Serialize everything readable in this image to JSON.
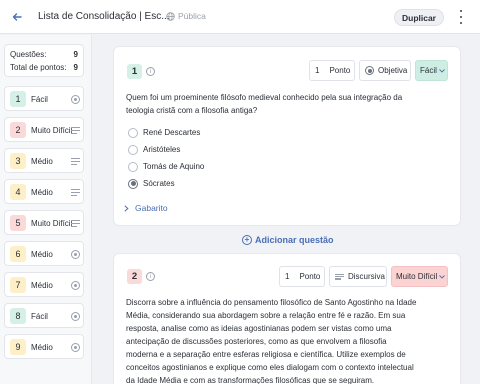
{
  "header": {
    "title": "Lista de Consolidação | Esc...",
    "visibility": "Pública",
    "duplicate_label": "Duplicar"
  },
  "sidebar": {
    "stats": [
      {
        "label": "Questões:",
        "value": "9"
      },
      {
        "label": "Total de pontos:",
        "value": "9"
      }
    ],
    "items": [
      {
        "number": "1",
        "difficulty": "Fácil",
        "type_icon": "radio-icon",
        "color": "#d6f0e8"
      },
      {
        "number": "2",
        "difficulty": "Muito Difícil",
        "type_icon": "lines-icon",
        "color": "#fbd9d9"
      },
      {
        "number": "3",
        "difficulty": "Médio",
        "type_icon": "lines-icon",
        "color": "#fdf0c8"
      },
      {
        "number": "4",
        "difficulty": "Médio",
        "type_icon": "lines-icon",
        "color": "#fdf0c8"
      },
      {
        "number": "5",
        "difficulty": "Muito Difícil",
        "type_icon": "lines-icon",
        "color": "#fbd9d9"
      },
      {
        "number": "6",
        "difficulty": "Médio",
        "type_icon": "radio-icon",
        "color": "#fdf0c8"
      },
      {
        "number": "7",
        "difficulty": "Médio",
        "type_icon": "radio-icon",
        "color": "#fdf0c8"
      },
      {
        "number": "8",
        "difficulty": "Fácil",
        "type_icon": "radio-icon",
        "color": "#d6f0e8"
      },
      {
        "number": "9",
        "difficulty": "Médio",
        "type_icon": "radio-icon",
        "color": "#fdf0c8"
      }
    ]
  },
  "question1": {
    "number": "1",
    "points_value": "1",
    "points_label": "Ponto",
    "type_label": "Objetiva",
    "difficulty": "Fácil",
    "difficulty_color": "#cfeee3",
    "text": "Quem foi um proeminente filósofo medieval conhecido pela sua integração da teologia cristã com a filosofia antiga?",
    "options": [
      "René Descartes",
      "Aristóteles",
      "Tomás de Aquino",
      "Sócrates"
    ],
    "selected_option": "Sócrates",
    "answer_key_label": "Gabarito"
  },
  "add_question_label": "Adicionar questão",
  "question2": {
    "number": "2",
    "points_value": "1",
    "points_label": "Ponto",
    "type_label": "Discursiva",
    "difficulty": "Muito Difícil",
    "difficulty_color": "#fbd3d3",
    "text": "Discorra sobre a influência do pensamento filosófico de Santo Agostinho na Idade Média, considerando sua abordagem sobre a relação entre fé e razão. Em sua resposta, analise como as ideias agostinianas podem ser vistas como uma antecipação de discussões posteriores, como as que envolvem a filosofia moderna e a separação entre esferas religiosa e científica. Utilize exemplos de conceitos agostinianos e explique como eles dialogam com o contexto intelectual da Idade Média e com as transformações filosóficas que se seguiram."
  },
  "colors": {
    "accent": "#4a6fb5"
  }
}
